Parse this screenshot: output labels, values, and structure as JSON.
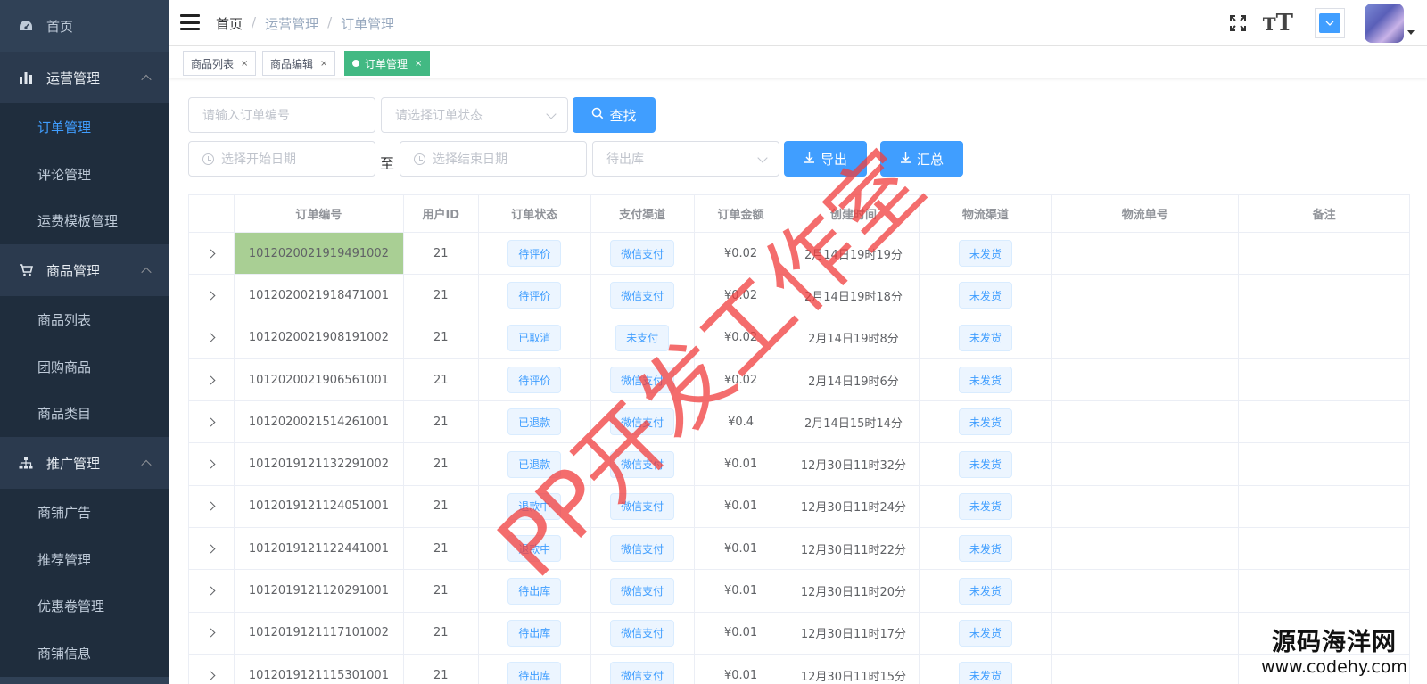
{
  "sidebar": {
    "items": [
      {
        "label": "首页",
        "type": "top",
        "icon": "dashboard-icon"
      },
      {
        "label": "运营管理",
        "type": "group",
        "icon": "chart-icon"
      },
      {
        "label": "订单管理",
        "type": "sub",
        "active": true
      },
      {
        "label": "评论管理",
        "type": "sub"
      },
      {
        "label": "运费模板管理",
        "type": "sub"
      },
      {
        "label": "商品管理",
        "type": "group",
        "icon": "cart-icon"
      },
      {
        "label": "商品列表",
        "type": "sub"
      },
      {
        "label": "团购商品",
        "type": "sub"
      },
      {
        "label": "商品类目",
        "type": "sub"
      },
      {
        "label": "推广管理",
        "type": "group",
        "icon": "sitemap-icon"
      },
      {
        "label": "商铺广告",
        "type": "sub"
      },
      {
        "label": "推荐管理",
        "type": "sub"
      },
      {
        "label": "优惠卷管理",
        "type": "sub"
      },
      {
        "label": "商铺信息",
        "type": "sub"
      }
    ]
  },
  "header": {
    "breadcrumb": [
      "首页",
      "运营管理",
      "订单管理"
    ],
    "separator": "/",
    "size_icon_text": "T"
  },
  "tags": [
    {
      "label": "商品列表",
      "close": "×"
    },
    {
      "label": "商品编辑",
      "close": "×"
    },
    {
      "label": "订单管理",
      "close": "×"
    }
  ],
  "filters": {
    "order_no_placeholder": "请输入订单编号",
    "status_placeholder": "请选择订单状态",
    "search_label": "查找",
    "start_date_placeholder": "选择开始日期",
    "to_label": "至",
    "end_date_placeholder": "选择结束日期",
    "stock_select_value": "待出库",
    "export_label": "导出",
    "summary_label": "汇总"
  },
  "table": {
    "columns": [
      "",
      "订单编号",
      "用户ID",
      "订单状态",
      "支付渠道",
      "订单金额",
      "创建时间",
      "物流渠道",
      "物流单号",
      "备注"
    ],
    "rows": [
      {
        "order_no": "1012020021919491002",
        "user_id": "21",
        "status": "待评价",
        "pay": "微信支付",
        "amount": "¥0.02",
        "created": "2月14日19时19分",
        "logistics": "未发货",
        "tracking": "",
        "remark": ""
      },
      {
        "order_no": "1012020021918471001",
        "user_id": "21",
        "status": "待评价",
        "pay": "微信支付",
        "amount": "¥0.02",
        "created": "2月14日19时18分",
        "logistics": "未发货",
        "tracking": "",
        "remark": ""
      },
      {
        "order_no": "1012020021908191002",
        "user_id": "21",
        "status": "已取消",
        "pay": "未支付",
        "amount": "¥0.02",
        "created": "2月14日19时8分",
        "logistics": "未发货",
        "tracking": "",
        "remark": ""
      },
      {
        "order_no": "1012020021906561001",
        "user_id": "21",
        "status": "待评价",
        "pay": "微信支付",
        "amount": "¥0.02",
        "created": "2月14日19时6分",
        "logistics": "未发货",
        "tracking": "",
        "remark": ""
      },
      {
        "order_no": "1012020021514261001",
        "user_id": "21",
        "status": "已退款",
        "pay": "微信支付",
        "amount": "¥0.4",
        "created": "2月14日15时14分",
        "logistics": "未发货",
        "tracking": "",
        "remark": ""
      },
      {
        "order_no": "1012019121132291002",
        "user_id": "21",
        "status": "已退款",
        "pay": "微信支付",
        "amount": "¥0.01",
        "created": "12月30日11时32分",
        "logistics": "未发货",
        "tracking": "",
        "remark": ""
      },
      {
        "order_no": "1012019121124051001",
        "user_id": "21",
        "status": "退款中",
        "pay": "微信支付",
        "amount": "¥0.01",
        "created": "12月30日11时24分",
        "logistics": "未发货",
        "tracking": "",
        "remark": ""
      },
      {
        "order_no": "1012019121122441001",
        "user_id": "21",
        "status": "退款中",
        "pay": "微信支付",
        "amount": "¥0.01",
        "created": "12月30日11时22分",
        "logistics": "未发货",
        "tracking": "",
        "remark": ""
      },
      {
        "order_no": "1012019121120291001",
        "user_id": "21",
        "status": "待出库",
        "pay": "微信支付",
        "amount": "¥0.01",
        "created": "12月30日11时20分",
        "logistics": "未发货",
        "tracking": "",
        "remark": ""
      },
      {
        "order_no": "1012019121117101002",
        "user_id": "21",
        "status": "待出库",
        "pay": "微信支付",
        "amount": "¥0.01",
        "created": "12月30日11时17分",
        "logistics": "未发货",
        "tracking": "",
        "remark": ""
      },
      {
        "order_no": "1012019121115301001",
        "user_id": "21",
        "status": "待出库",
        "pay": "微信支付",
        "amount": "¥0.01",
        "created": "12月30日11时15分",
        "logistics": "未发货",
        "tracking": "",
        "remark": ""
      }
    ]
  },
  "watermark": {
    "text": "PP开发工作室",
    "site_name": "源码海洋网",
    "site_url": "www.codehy.com"
  },
  "colors": {
    "sidebar_bg": "#304156",
    "submenu_bg": "#1f2d3d",
    "accent": "#409eff",
    "active_tag": "#42b983",
    "highlight_cell": "#a9cf94",
    "watermark": "#f03c3c"
  }
}
